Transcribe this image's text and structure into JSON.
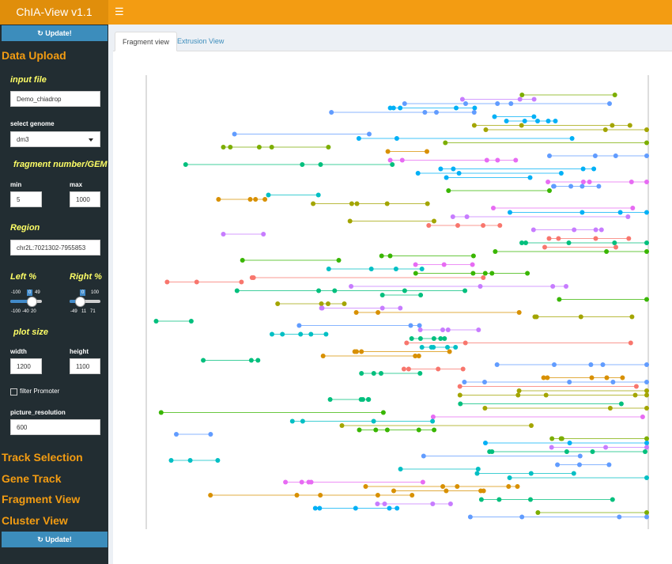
{
  "app": {
    "title": "ChIA-View v1.1"
  },
  "sidebar": {
    "update_label": "↻ Update!",
    "data_upload": "Data Upload",
    "input_file": {
      "label": "input file",
      "value": "Demo_chiadrop"
    },
    "genome": {
      "label": "select genome",
      "value": "dm3"
    },
    "fragment": {
      "label": "fragment number/GEM",
      "min_label": "min",
      "min_value": "5",
      "max_label": "max",
      "max_value": "1000"
    },
    "region": {
      "label": "Region",
      "value": "chr2L:7021302-7955853"
    },
    "left_pct": {
      "label": "Left %",
      "min": "-100",
      "max": "49",
      "value": "0",
      "ticks": [
        "-100",
        "-40",
        "20"
      ],
      "level": 0.67
    },
    "right_pct": {
      "label": "Right %",
      "min": "-49",
      "max": "100",
      "value": "0",
      "ticks": [
        "-49",
        "11",
        "71"
      ],
      "level": 0.33
    },
    "plot_size": {
      "label": "plot size",
      "width_label": "width",
      "width_value": "1200",
      "height_label": "height",
      "height_value": "1100"
    },
    "filter_promoter": {
      "label": "filter Promoter",
      "checked": false
    },
    "picture_resolution": {
      "label": "picture_resolution",
      "value": "600"
    },
    "sections": [
      "Track Selection",
      "Gene Track",
      "Fragment View",
      "Cluster View"
    ]
  },
  "tabs": [
    {
      "label": "Fragment view",
      "active": true
    },
    {
      "label": "Extrusion View",
      "active": false
    }
  ],
  "colors": {
    "topbar": "#f39c12",
    "logo": "#e08e0b",
    "sidebar": "#222d32",
    "button": "#3c8dbc",
    "section_title": "#f39c12",
    "input_label": "#ffff66",
    "fragment_palette": [
      "#f8766d",
      "#e76bf3",
      "#c77cff",
      "#619cff",
      "#00b0f6",
      "#00bfc4",
      "#00bf7d",
      "#7cae00",
      "#a3a500",
      "#d89000",
      "#39b600"
    ]
  }
}
